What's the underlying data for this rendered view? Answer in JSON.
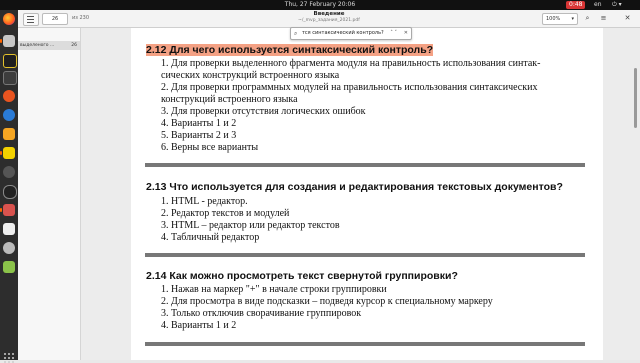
{
  "topbar": {
    "activities": "",
    "clock": "Thu, 27 February 20:06",
    "record_badge": "0:48",
    "keyboard_layout": "en"
  },
  "viewer": {
    "page_current": "26",
    "page_total": "из 230",
    "title": "Введение",
    "subtitle": "~/_mvp_задания_2021.pdf",
    "zoom": "100%",
    "search_text": "тся синтаксический контроль?",
    "sidebar_item": {
      "title": "выделеного ...",
      "page": "26"
    }
  },
  "document": {
    "questions": [
      {
        "title": "2.12 Для чего используется синтаксический контроль?",
        "options": [
          "1. Для проверки выделенного фрагмента модуля на правильность использования синтак-",
          "сических конструкций встроенного языка",
          "2. Для проверки программных модулей на правильность использования синтаксических",
          "конструкций встроенного языка",
          "3. Для проверки отсутствия логических ошибок",
          "4. Варианты 1 и 2",
          "5. Варианты 2 и 3",
          "6. Верны все варианты"
        ]
      },
      {
        "title": "2.13 Что используется для создания и редактирования текстовых документов?",
        "options": [
          "1. HTML - редактор.",
          "2. Редактор текстов и модулей",
          "3. HTML – редактор или редактор текстов",
          "4. Табличный редактор"
        ]
      },
      {
        "title": "2.14 Как можно просмотреть текст свернутой группировки?",
        "options": [
          "1. Нажав на маркер \"+\" в начале строки группировки",
          "2. Для просмотра в виде подсказки – подведя курсор к специальному маркеру",
          "3. Только отключив сворачивание группировок",
          "4. Варианты 1 и 2"
        ]
      }
    ]
  },
  "colors": {
    "highlight": "#f4a184",
    "dock": "#2d2d2d",
    "topbar": "#111111"
  },
  "icons": [
    "firefox-icon",
    "files-icon",
    "system-monitor-icon",
    "terminal-icon",
    "help-icon",
    "1c-icon",
    "settings-icon",
    "obs-icon",
    "text-editor-icon",
    "trash-icon",
    "show-apps-icon"
  ]
}
